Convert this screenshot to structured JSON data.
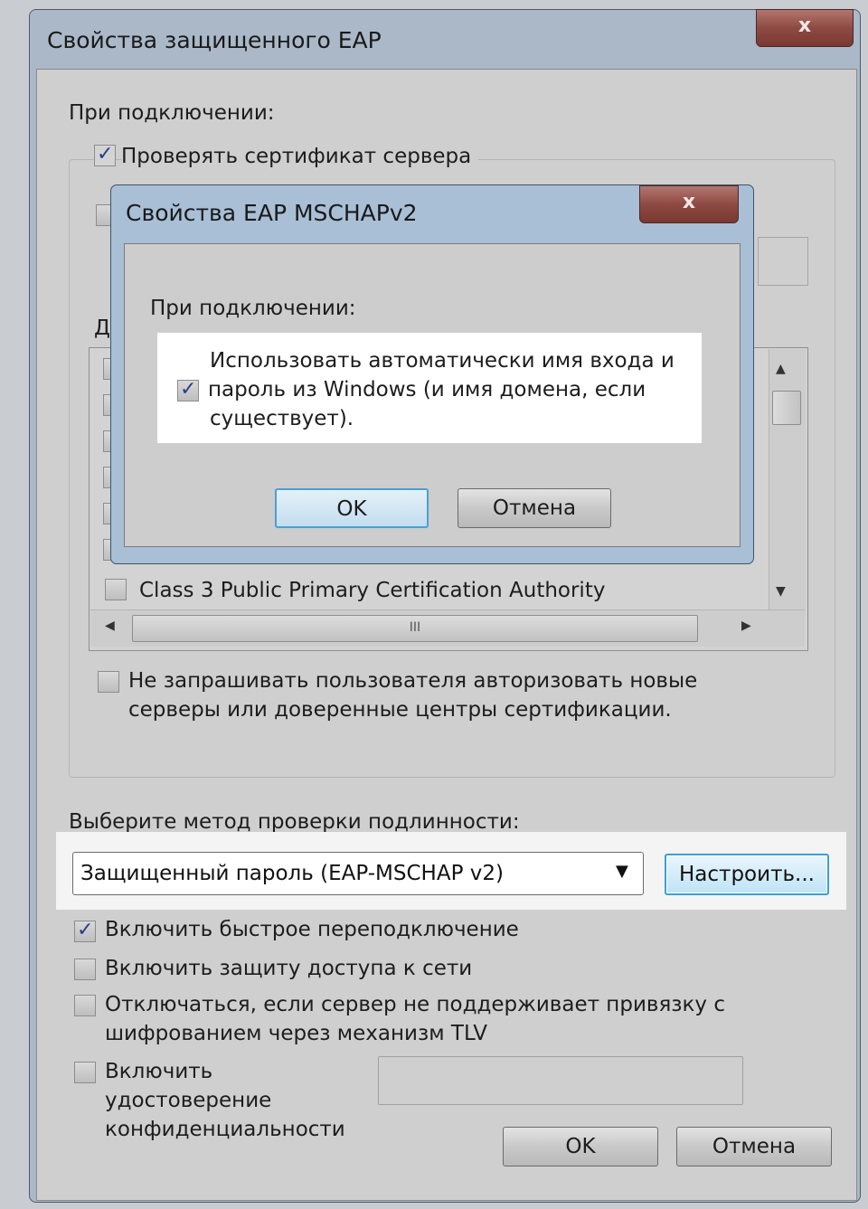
{
  "main": {
    "title": "Свойства защищенного EAP",
    "close_label": "x",
    "on_connect_label": "При подключении:",
    "verify_cert_label": "Проверять сертификат сервера",
    "verify_cert_checked": true,
    "trusted_ca_partial": "Д",
    "cert_list_visible_item": "Class 3 Public Primary Certification Authority",
    "scrollbar_grip": "III",
    "no_prompt_label_line1": "Не запрашивать пользователя авторизовать новые",
    "no_prompt_label_line2": "серверы или доверенные центры сертификации.",
    "method_label": "Выберите метод проверки подлинности:",
    "method_value": "Защищенный пароль (EAP-MSCHAP v2)",
    "configure_button": "Настроить...",
    "fast_reconnect_label": "Включить быстрое переподключение",
    "fast_reconnect_checked": true,
    "nap_label": "Включить защиту доступа к сети",
    "disconnect_label_line1": "Отключаться, если сервер не поддерживает привязку с",
    "disconnect_label_line2": "шифрованием через механизм TLV",
    "privacy_label_line1": "Включить",
    "privacy_label_line2": "удостоверение",
    "privacy_label_line3": "конфиденциальности",
    "ok_button": "OK",
    "cancel_button": "Отмена"
  },
  "inner": {
    "title": "Свойства EAP MSCHAPv2",
    "close_label": "x",
    "on_connect_label": "При подключении:",
    "auto_login_line1": "Использовать автоматически имя входа и",
    "auto_login_line2": "пароль из Windows (и имя домена, если",
    "auto_login_line3": "существует).",
    "auto_login_checked": true,
    "ok_button": "OK",
    "cancel_button": "Отмена"
  }
}
